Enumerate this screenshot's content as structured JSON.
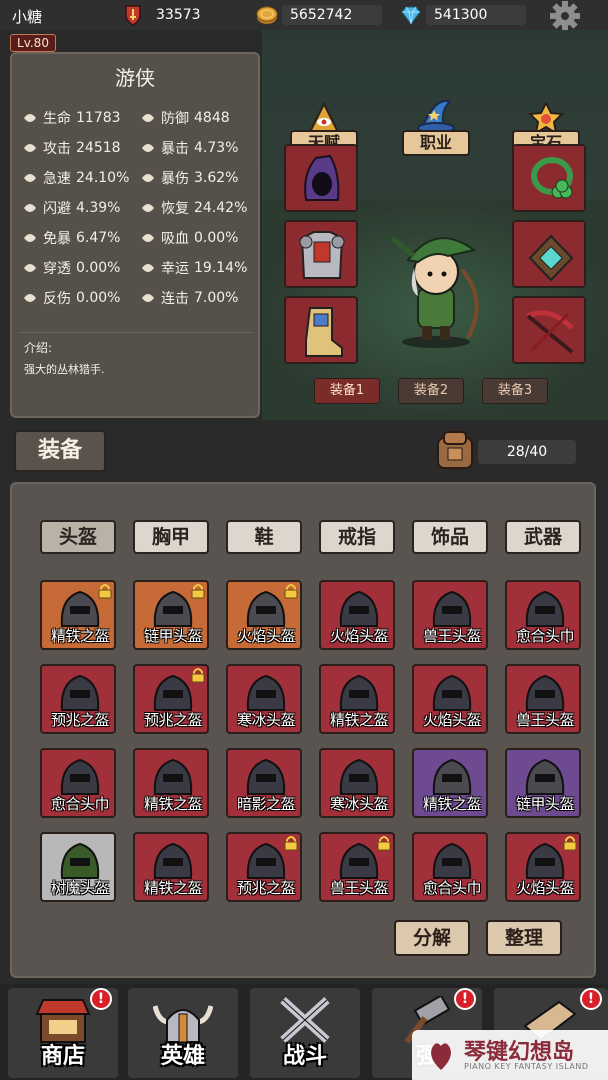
{
  "player": {
    "name": "小糖",
    "level": "Lv.80"
  },
  "resources": {
    "power": "33573",
    "gold": "5652742",
    "gems": "541300"
  },
  "hero": {
    "class": "游侠",
    "stats": [
      {
        "label": "生命",
        "value": "11783"
      },
      {
        "label": "防御",
        "value": "4848"
      },
      {
        "label": "攻击",
        "value": "24518"
      },
      {
        "label": "暴击",
        "value": "4.73%"
      },
      {
        "label": "急速",
        "value": "24.10%"
      },
      {
        "label": "暴伤",
        "value": "3.62%"
      },
      {
        "label": "闪避",
        "value": "4.39%"
      },
      {
        "label": "恢复",
        "value": "24.42%"
      },
      {
        "label": "免暴",
        "value": "6.47%"
      },
      {
        "label": "吸血",
        "value": "0.00%"
      },
      {
        "label": "穿透",
        "value": "0.00%"
      },
      {
        "label": "幸运",
        "value": "19.14%"
      },
      {
        "label": "反伤",
        "value": "0.00%"
      },
      {
        "label": "连击",
        "value": "7.00%"
      }
    ],
    "intro_label": "介绍:",
    "intro_text": "强大的丛林猎手."
  },
  "top_buttons": {
    "talent": "天赋",
    "job": "职业",
    "gem": "宝石"
  },
  "loadouts": [
    "装备1",
    "装备2",
    "装备3"
  ],
  "equipment": {
    "tab_label": "装备",
    "bag_count": "28/40",
    "categories": [
      "头盔",
      "胸甲",
      "鞋",
      "戒指",
      "饰品",
      "武器"
    ],
    "items": [
      {
        "name": "精铁之盔",
        "rarity": "orange",
        "locked": true
      },
      {
        "name": "链甲头盔",
        "rarity": "orange",
        "locked": true
      },
      {
        "name": "火焰头盔",
        "rarity": "orange",
        "locked": true
      },
      {
        "name": "火焰头盔",
        "rarity": "red",
        "locked": false
      },
      {
        "name": "兽王头盔",
        "rarity": "red",
        "locked": false
      },
      {
        "name": "愈合头巾",
        "rarity": "red",
        "locked": false
      },
      {
        "name": "预兆之盔",
        "rarity": "red",
        "locked": false
      },
      {
        "name": "预兆之盔",
        "rarity": "red",
        "locked": true
      },
      {
        "name": "寒冰头盔",
        "rarity": "red",
        "locked": false
      },
      {
        "name": "精铁之盔",
        "rarity": "red",
        "locked": false
      },
      {
        "name": "火焰头盔",
        "rarity": "red",
        "locked": false
      },
      {
        "name": "兽王头盔",
        "rarity": "red",
        "locked": false
      },
      {
        "name": "愈合头巾",
        "rarity": "red",
        "locked": false
      },
      {
        "name": "精铁之盔",
        "rarity": "red",
        "locked": false
      },
      {
        "name": "暗影之盔",
        "rarity": "red",
        "locked": false
      },
      {
        "name": "寒冰头盔",
        "rarity": "red",
        "locked": false
      },
      {
        "name": "精铁之盔",
        "rarity": "purple",
        "locked": false
      },
      {
        "name": "链甲头盔",
        "rarity": "purple",
        "locked": false
      },
      {
        "name": "树魔头盔",
        "rarity": "gray",
        "locked": false
      },
      {
        "name": "精铁之盔",
        "rarity": "red",
        "locked": false
      },
      {
        "name": "预兆之盔",
        "rarity": "red",
        "locked": true
      },
      {
        "name": "兽王头盔",
        "rarity": "red",
        "locked": true
      },
      {
        "name": "愈合头巾",
        "rarity": "red",
        "locked": false
      },
      {
        "name": "火焰头盔",
        "rarity": "red",
        "locked": true
      }
    ],
    "decompose": "分解",
    "sort": "整理"
  },
  "nav": [
    {
      "label": "商店",
      "alert": "!"
    },
    {
      "label": "英雄",
      "alert": ""
    },
    {
      "label": "战斗",
      "alert": ""
    },
    {
      "label": "强",
      "alert": "!"
    },
    {
      "label": "",
      "alert": "!"
    }
  ],
  "watermark": {
    "main": "琴键幻想岛",
    "sub": "PIANO KEY FANTASY ISLAND"
  }
}
